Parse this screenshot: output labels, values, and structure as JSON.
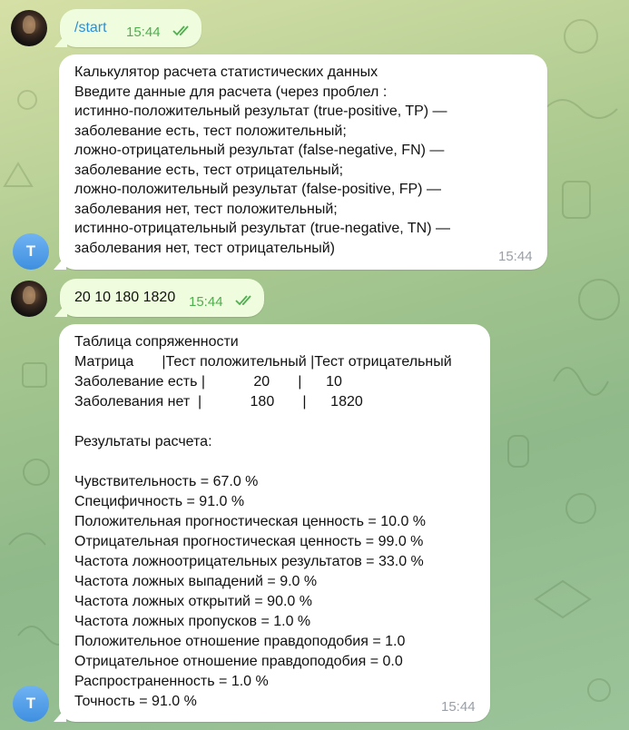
{
  "chat": {
    "messages": [
      {
        "id": "m1",
        "direction": "out",
        "text": "/start",
        "time": "15:44",
        "read": true
      },
      {
        "id": "m2",
        "direction": "in",
        "sender_initial": "T",
        "lines": [
          "Калькулятор расчета статистических данных",
          "Введите данные для расчета (через проблел :",
          "истинно-положительный результат (true-positive, TP) —",
          "заболевание есть, тест положительный;",
          "ложно-отрицательный результат (false-negative, FN) —",
          "заболевание есть, тест отрицательный;",
          "ложно-положительный результат (false-positive, FP) —",
          "заболевания нет, тест положительный;",
          "истинно-отрицательный результат (true-negative, TN) —",
          "заболевания нет, тест отрицательный)"
        ],
        "time": "15:44"
      },
      {
        "id": "m3",
        "direction": "out",
        "text": "20 10 180 1820",
        "time": "15:44",
        "read": true
      },
      {
        "id": "m4",
        "direction": "in",
        "sender_initial": "T",
        "lines": [
          "Таблица сопряженности",
          "Матрица       |Тест положительный |Тест отрицательный",
          "Заболевание есть |            20       |      10",
          "Заболевания нет  |            180       |      1820",
          "",
          "Результаты расчета:",
          "",
          "Чувствительность = 67.0 %",
          "Специфичность = 91.0 %",
          "Положительная прогностическая ценность = 10.0 %",
          "Отрицательная прогностическая ценность = 99.0 %",
          "Частота ложноотрицательных результатов = 33.0 %",
          "Частота ложных выпадений = 9.0 %",
          "Частота ложных открытий = 90.0 %",
          "Частота ложных пропусков = 1.0 %",
          "Положительное отношение правдоподобия = 1.0",
          "Отрицательное отношение правдоподобия = 0.0",
          "Распространенность = 1.0 %",
          "Точность = 91.0 %"
        ],
        "time": "15:44"
      }
    ]
  },
  "colors": {
    "outgoing_bubble": "#effdde",
    "incoming_bubble": "#ffffff",
    "read_checks": "#4fae4e",
    "avatar_letter_bg": "#4a97e4"
  },
  "icons": [
    "double-check-icon",
    "user-avatar",
    "bot-avatar-letter"
  ]
}
